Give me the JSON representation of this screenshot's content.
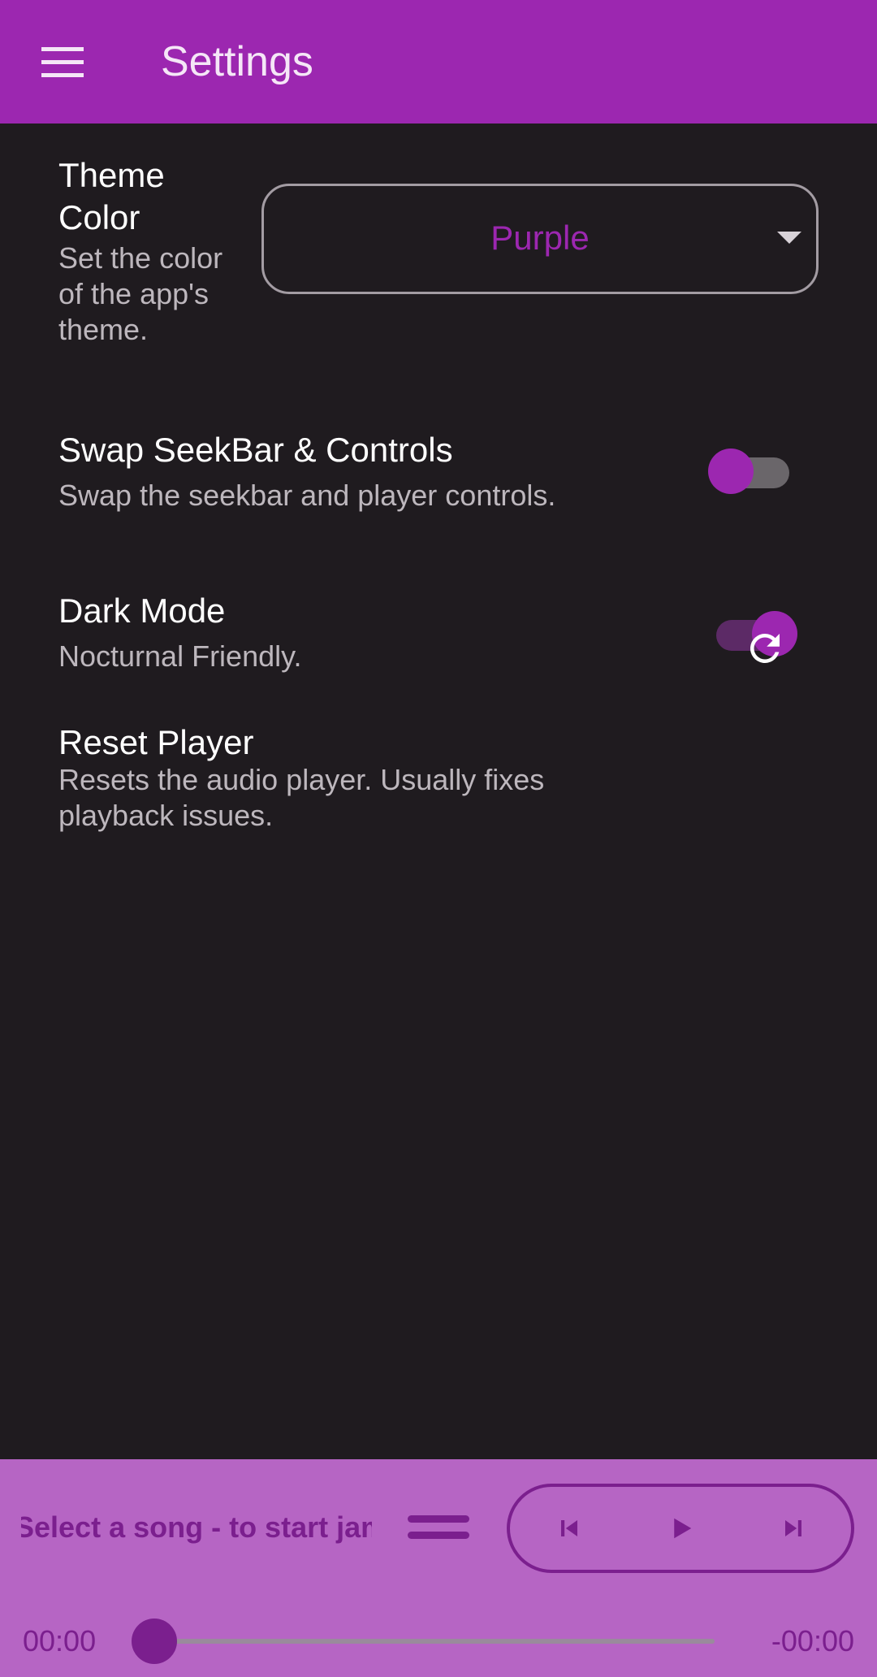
{
  "appbar": {
    "title": "Settings",
    "background": "#9c27b0",
    "menu_icon": "menu-icon"
  },
  "settings": {
    "theme_color": {
      "title": "Theme Color",
      "subtitle": "Set the color of the app's theme.",
      "selected": "Purple"
    },
    "swap_seekbar": {
      "title": "Swap SeekBar & Controls",
      "subtitle": "Swap the seekbar and player controls.",
      "enabled": false
    },
    "dark_mode": {
      "title": "Dark Mode",
      "subtitle": "Nocturnal Friendly.",
      "enabled": true
    },
    "reset_player": {
      "title": "Reset Player",
      "subtitle": "Resets the audio player. Usually fixes playback issues.",
      "icon": "refresh-icon"
    }
  },
  "player": {
    "marquee_text": "Select a song - to start jamming",
    "elapsed": "00:00",
    "remaining": "-00:00",
    "progress": 0,
    "icons": {
      "queue": "drag-handle-icon",
      "previous": "skip-previous-icon",
      "play": "play-icon",
      "next": "skip-next-icon"
    },
    "background": "#b665c4",
    "accent": "#7b1f8e"
  },
  "colors": {
    "accent": "#9c27b0",
    "page_background": "#1f1b1f"
  }
}
